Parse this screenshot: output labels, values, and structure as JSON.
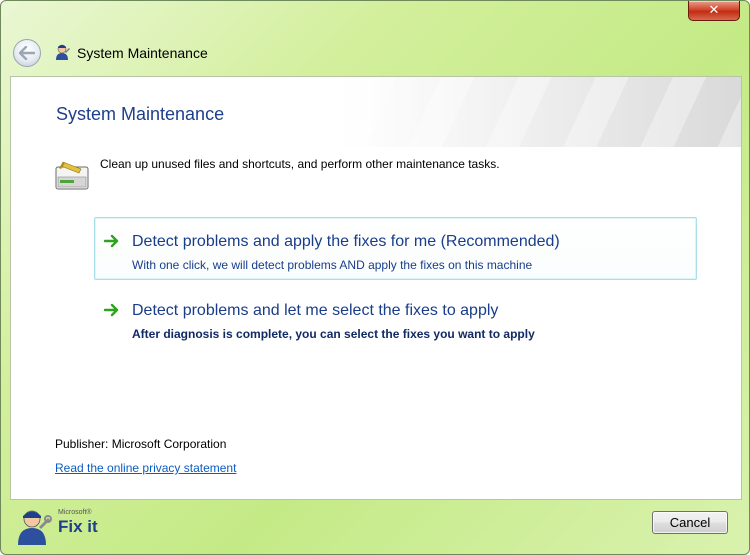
{
  "window": {
    "title": "System Maintenance",
    "close_label": "✕"
  },
  "page": {
    "title": "System Maintenance",
    "description": "Clean up unused files and shortcuts, and perform other maintenance tasks."
  },
  "options": [
    {
      "title": "Detect problems and apply the fixes for me (Recommended)",
      "subtitle": "With one click, we will detect problems AND apply the fixes on this machine",
      "selected": true
    },
    {
      "title": "Detect problems and let me select the fixes to apply",
      "subtitle": "After diagnosis is complete, you can select the fixes you want to apply",
      "selected": false
    }
  ],
  "footer": {
    "publisher": "Publisher: Microsoft Corporation",
    "privacy_link": "Read the online privacy statement",
    "cancel_label": "Cancel"
  },
  "logo": {
    "brand_small": "Microsoft®",
    "brand_large": "Fix it"
  },
  "icons": {
    "back": "back-arrow-icon",
    "title": "fixit-technician-icon",
    "task": "disk-cleanup-icon",
    "option_arrow": "green-arrow-icon"
  },
  "colors": {
    "accent_blue": "#1a3d8a",
    "link_blue": "#0b5cc2",
    "arrow_green": "#2fa21f",
    "selected_border": "#a8dde9",
    "frame_green": "#c4ea86"
  }
}
